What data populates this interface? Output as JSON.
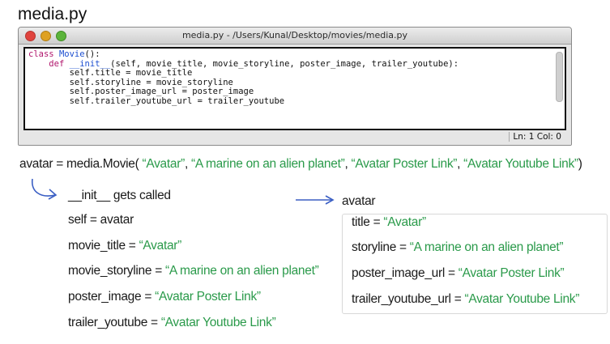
{
  "heading": "media.py",
  "window": {
    "title": "media.py - /Users/Kunal/Desktop/movies/media.py",
    "status": "Ln: 1 Col: 0"
  },
  "code": {
    "l1_kw": "class",
    "l1_name": "Movie",
    "l1_rest": "():",
    "l2_kw": "def",
    "l2_name": "__init__",
    "l2_rest": "(self, movie_title, movie_storyline, poster_image, trailer_youtube):",
    "l3": "self.title = movie_title",
    "l4": "self.storyline = movie_storyline",
    "l5": "self.poster_image_url = poster_image",
    "l6": "self.trailer_youtube_url = trailer_youtube"
  },
  "instantiation": {
    "prefix": "avatar = media.Movie( ",
    "arg1": "“Avatar”",
    "sep1": ", ",
    "arg2": "“A marine on an alien planet”",
    "sep2": ",  ",
    "arg3": "“Avatar Poster Link”",
    "sep3": ",  ",
    "arg4": "“Avatar Youtube Link”",
    "suffix": ")"
  },
  "call_steps": {
    "init": "__init__ gets called",
    "self_label": "self = avatar",
    "movie_title_label": "movie_title = ",
    "movie_title_value": "“Avatar”",
    "movie_storyline_label": "movie_storyline = ",
    "movie_storyline_value": "“A marine on an alien planet”",
    "poster_image_label": "poster_image = ",
    "poster_image_value": "“Avatar Poster Link”",
    "trailer_youtube_label": "trailer_youtube = ",
    "trailer_youtube_value": "“Avatar Youtube Link”"
  },
  "object": {
    "name": "avatar",
    "title_label": "title = ",
    "title_value": "“Avatar”",
    "storyline_label": "storyline = ",
    "storyline_value": "“A marine on an alien planet”",
    "poster_label": "poster_image_url = ",
    "poster_value": "“Avatar Poster Link”",
    "trailer_label": "trailer_youtube_url = ",
    "trailer_value": "“Avatar Youtube Link”"
  },
  "colors": {
    "string_green": "#2a9a4a",
    "keyword_magenta": "#b0146b",
    "name_blue": "#1d4fd0",
    "arrow_blue": "#3b5fc4"
  },
  "icons": [
    "close-light",
    "minimize-light",
    "zoom-light",
    "curved-arrow",
    "right-arrow"
  ]
}
